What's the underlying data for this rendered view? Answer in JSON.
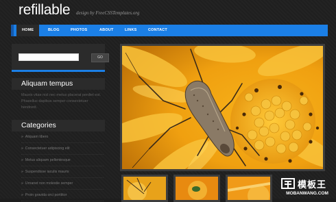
{
  "site": {
    "title": "refillable",
    "tagline": "design by FreeCSSTemplates.org"
  },
  "nav": {
    "items": [
      "HOME",
      "BLOG",
      "PHOTOS",
      "ABOUT",
      "LINKS",
      "CONTACT"
    ],
    "active": "HOME"
  },
  "search": {
    "value": "",
    "button_label": "GO"
  },
  "sidebar": {
    "about_heading": "Aliquam tempus",
    "about_text": "Mauris vitae nisl nec metus placerat perdiet est. Phasellus dapibus semper consectetuer hendrerit.",
    "categories_heading": "Categories",
    "categories": [
      "Aliquam libero",
      "Consectetuer adipiscing elit",
      "Metus aliquam pellentesque",
      "Suspendisse iaculis mauris",
      "Urnanet non molestie semper",
      "Proin gravida orci porttitor"
    ]
  },
  "watermark": {
    "title": "模板王",
    "url": "MOBANWANG.COM"
  },
  "colors": {
    "accent": "#1b7fe6",
    "background": "#1f1f1f",
    "panel": "#2b2b2b"
  }
}
